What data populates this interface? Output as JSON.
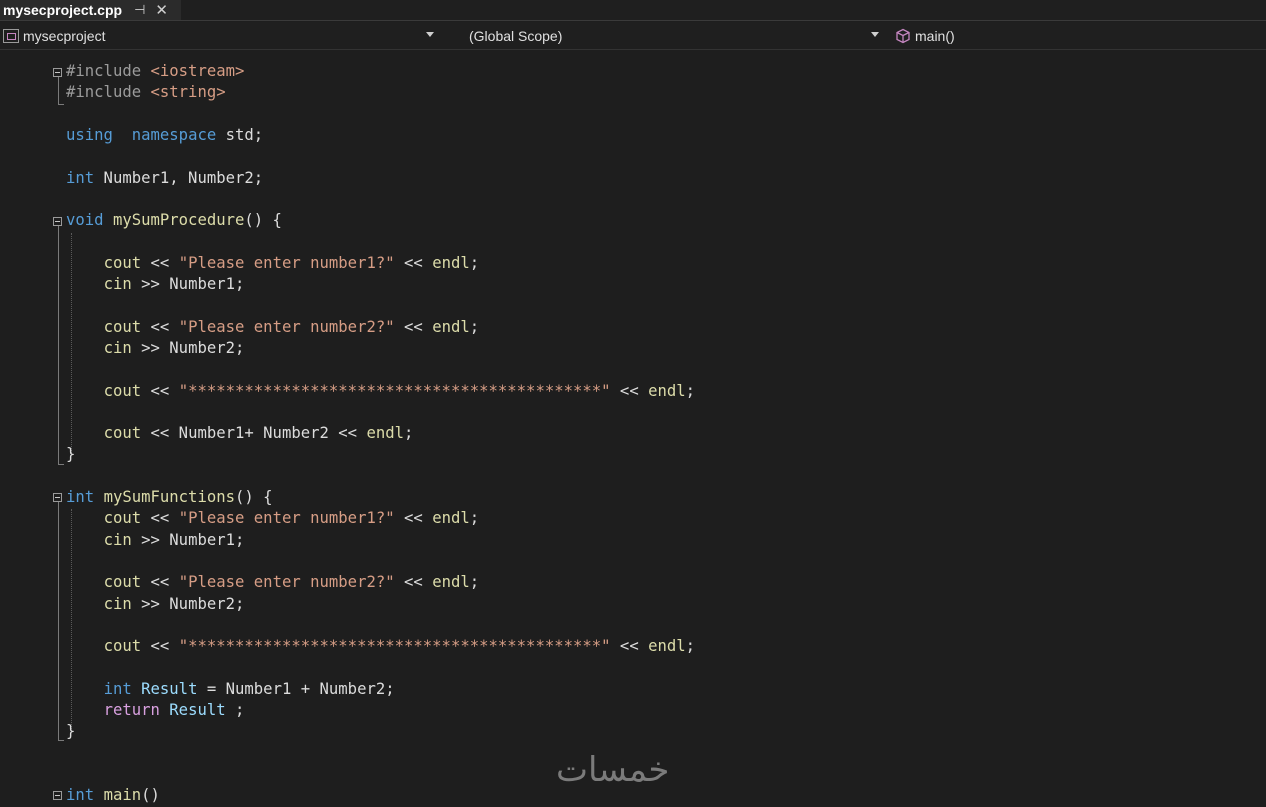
{
  "tab": {
    "title": "mysecproject.cpp",
    "pin_icon": "pin-icon",
    "close_icon": "close-icon"
  },
  "nav": {
    "project": "mysecproject",
    "scope": "(Global Scope)",
    "member": "main()"
  },
  "code_lines": [
    [
      [
        "pp",
        "#include "
      ],
      [
        "str",
        "<iostream>"
      ]
    ],
    [
      [
        "pp",
        "#include "
      ],
      [
        "str",
        "<string>"
      ]
    ],
    [],
    [
      [
        "kw",
        "using"
      ],
      [
        "",
        "  "
      ],
      [
        "kw",
        "namespace"
      ],
      [
        "",
        " std;"
      ]
    ],
    [],
    [
      [
        "kw",
        "int"
      ],
      [
        "",
        " Number1, Number2;"
      ]
    ],
    [],
    [
      [
        "kw",
        "void"
      ],
      [
        "",
        " "
      ],
      [
        "fn",
        "mySumProcedure"
      ],
      [
        "",
        "() {"
      ]
    ],
    [],
    [
      [
        "",
        "    "
      ],
      [
        "fn",
        "cout"
      ],
      [
        "",
        " << "
      ],
      [
        "str",
        "\"Please enter number1?\""
      ],
      [
        "",
        " << "
      ],
      [
        "fn",
        "endl"
      ],
      [
        "",
        ";"
      ]
    ],
    [
      [
        "",
        "    "
      ],
      [
        "fn",
        "cin"
      ],
      [
        "",
        " >> Number1;"
      ]
    ],
    [],
    [
      [
        "",
        "    "
      ],
      [
        "fn",
        "cout"
      ],
      [
        "",
        " << "
      ],
      [
        "str",
        "\"Please enter number2?\""
      ],
      [
        "",
        " << "
      ],
      [
        "fn",
        "endl"
      ],
      [
        "",
        ";"
      ]
    ],
    [
      [
        "",
        "    "
      ],
      [
        "fn",
        "cin"
      ],
      [
        "",
        " >> Number2;"
      ]
    ],
    [],
    [
      [
        "",
        "    "
      ],
      [
        "fn",
        "cout"
      ],
      [
        "",
        " << "
      ],
      [
        "str",
        "\"********************************************\""
      ],
      [
        "",
        " << "
      ],
      [
        "fn",
        "endl"
      ],
      [
        "",
        ";"
      ]
    ],
    [],
    [
      [
        "",
        "    "
      ],
      [
        "fn",
        "cout"
      ],
      [
        "",
        " << Number1+ Number2 << "
      ],
      [
        "fn",
        "endl"
      ],
      [
        "",
        ";"
      ]
    ],
    [
      [
        "",
        "}"
      ]
    ],
    [],
    [
      [
        "kw",
        "int"
      ],
      [
        "",
        " "
      ],
      [
        "fn",
        "mySumFunctions"
      ],
      [
        "",
        "() {"
      ]
    ],
    [
      [
        "",
        "    "
      ],
      [
        "fn",
        "cout"
      ],
      [
        "",
        " << "
      ],
      [
        "str",
        "\"Please enter number1?\""
      ],
      [
        "",
        " << "
      ],
      [
        "fn",
        "endl"
      ],
      [
        "",
        ";"
      ]
    ],
    [
      [
        "",
        "    "
      ],
      [
        "fn",
        "cin"
      ],
      [
        "",
        " >> Number1;"
      ]
    ],
    [],
    [
      [
        "",
        "    "
      ],
      [
        "fn",
        "cout"
      ],
      [
        "",
        " << "
      ],
      [
        "str",
        "\"Please enter number2?\""
      ],
      [
        "",
        " << "
      ],
      [
        "fn",
        "endl"
      ],
      [
        "",
        ";"
      ]
    ],
    [
      [
        "",
        "    "
      ],
      [
        "fn",
        "cin"
      ],
      [
        "",
        " >> Number2;"
      ]
    ],
    [],
    [
      [
        "",
        "    "
      ],
      [
        "fn",
        "cout"
      ],
      [
        "",
        " << "
      ],
      [
        "str",
        "\"********************************************\""
      ],
      [
        "",
        " << "
      ],
      [
        "fn",
        "endl"
      ],
      [
        "",
        ";"
      ]
    ],
    [],
    [
      [
        "",
        "    "
      ],
      [
        "kw",
        "int"
      ],
      [
        "",
        " "
      ],
      [
        "var",
        "Result"
      ],
      [
        "",
        " = Number1 + Number2;"
      ]
    ],
    [
      [
        "",
        "    "
      ],
      [
        "ctl",
        "return"
      ],
      [
        "",
        " "
      ],
      [
        "var",
        "Result"
      ],
      [
        "",
        " ;"
      ]
    ],
    [
      [
        "",
        "}"
      ]
    ],
    [],
    [],
    [
      [
        "kw",
        "int"
      ],
      [
        "",
        " "
      ],
      [
        "fn",
        "main"
      ],
      [
        "",
        "()"
      ]
    ]
  ],
  "watermark": "خمسات",
  "colors": {
    "background": "#1e1e1e",
    "keyword": "#569cd6",
    "string": "#d69d85",
    "function": "#dcdcaa",
    "variable": "#9cdcfe",
    "control": "#d8a0df",
    "preprocessor": "#9b9b9b"
  }
}
